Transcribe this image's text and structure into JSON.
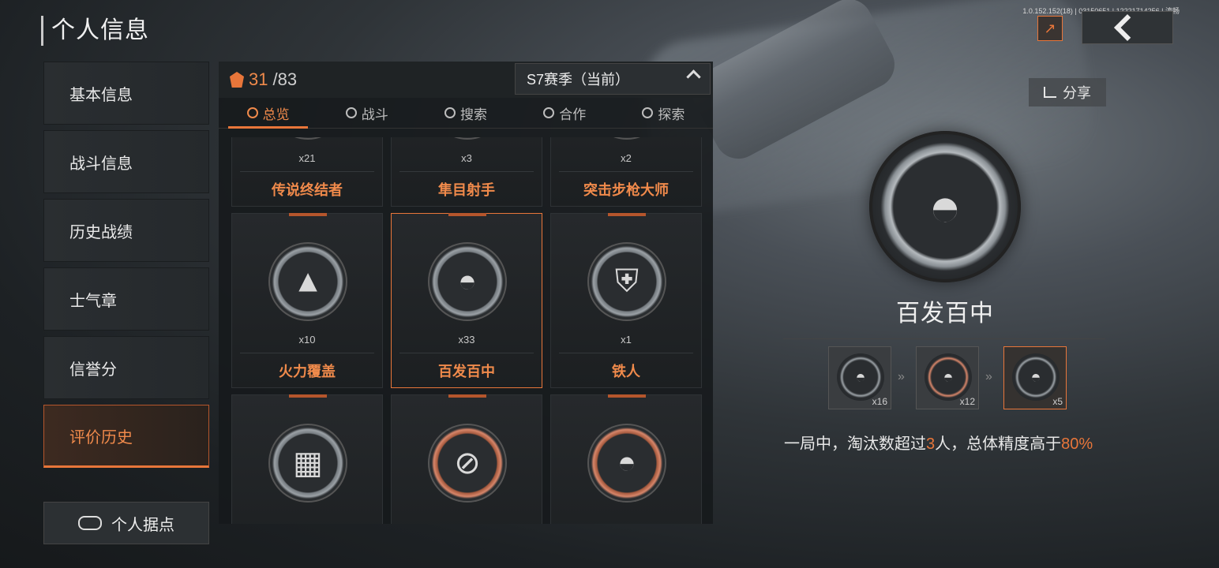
{
  "top_info": "1.0.152.152(18) | 03150651 | 12221714256 | 流畅",
  "page_title": "个人信息",
  "sidebar": {
    "items": [
      {
        "label": "基本信息"
      },
      {
        "label": "战斗信息"
      },
      {
        "label": "历史战绩"
      },
      {
        "label": "士气章"
      },
      {
        "label": "信誉分"
      },
      {
        "label": "评价历史",
        "active": true
      }
    ],
    "base_button": "个人据点"
  },
  "panel": {
    "count_current": "31",
    "count_total": "/83",
    "season_label": "S7赛季（当前）",
    "tabs": [
      {
        "label": "总览",
        "active": true
      },
      {
        "label": "战斗"
      },
      {
        "label": "搜索"
      },
      {
        "label": "合作"
      },
      {
        "label": "探索"
      }
    ],
    "medals": [
      {
        "name": "传说终结者",
        "mult": "x21",
        "icon": "legend-icon",
        "glyph": "♛"
      },
      {
        "name": "隼目射手",
        "mult": "x3",
        "icon": "scope-icon",
        "glyph": "⌖"
      },
      {
        "name": "突击步枪大师",
        "mult": "x2",
        "icon": "crossed-rifles-icon",
        "glyph": "✕"
      },
      {
        "name": "火力覆盖",
        "mult": "x10",
        "icon": "arrowhead-icon",
        "glyph": "▲"
      },
      {
        "name": "百发百中",
        "mult": "x33",
        "icon": "helmet-icon",
        "glyph": "◓",
        "selected": true
      },
      {
        "name": "铁人",
        "mult": "x1",
        "icon": "soldier-shield-icon",
        "glyph": "⛨"
      },
      {
        "name": "",
        "mult": "",
        "icon": "crates-icon",
        "glyph": "▦"
      },
      {
        "name": "",
        "mult": "",
        "icon": "dogtag-icon",
        "glyph": "⊘",
        "orange": true
      },
      {
        "name": "",
        "mult": "",
        "icon": "helmet-icon",
        "glyph": "◓",
        "orange": true
      }
    ]
  },
  "detail": {
    "share_label": "分享",
    "medal_name": "百发百中",
    "tiers": [
      {
        "mult": "x16"
      },
      {
        "mult": "x12",
        "orange": true
      },
      {
        "mult": "x5",
        "selected": true
      }
    ],
    "desc_prefix": "一局中，淘汰数超过",
    "desc_num1": "3",
    "desc_mid": "人，总体精度高于",
    "desc_num2": "80%"
  },
  "colors": {
    "accent": "#e8763a",
    "text": "#e6e6e6"
  }
}
